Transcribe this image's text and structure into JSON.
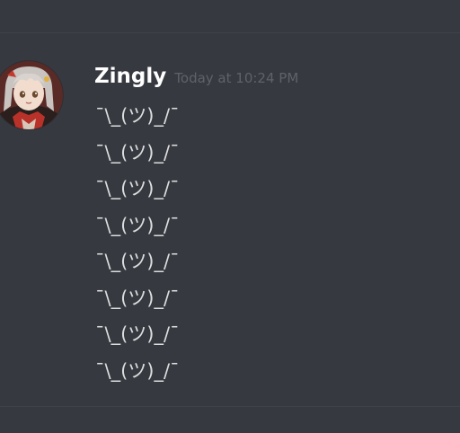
{
  "message": {
    "author": "Zingly",
    "timestamp": "Today at 10:24 PM",
    "lines": [
      "¯\\_(ツ)_/¯",
      "¯\\_(ツ)_/¯",
      "¯\\_(ツ)_/¯",
      "¯\\_(ツ)_/¯",
      "¯\\_(ツ)_/¯",
      "¯\\_(ツ)_/¯",
      "¯\\_(ツ)_/¯",
      "¯\\_(ツ)_/¯"
    ]
  },
  "colors": {
    "background": "#36393f",
    "username": "#ffffff",
    "timestamp": "#5f6268",
    "message_text": "#dcddde",
    "divider": "#3f4249"
  },
  "icons": {
    "avatar": "anime-character-avatar"
  }
}
